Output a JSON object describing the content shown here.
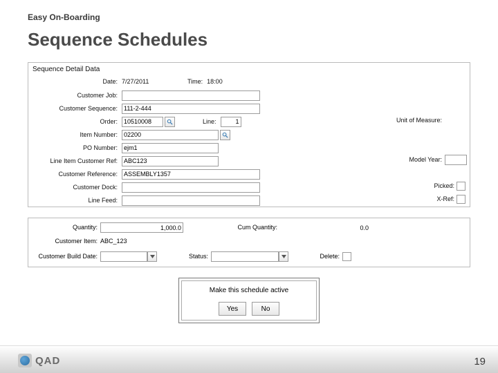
{
  "header": {
    "kicker": "Easy On-Boarding",
    "title": "Sequence Schedules"
  },
  "panel1": {
    "section_title": "Sequence Detail Data",
    "date_label": "Date:",
    "date_value": "7/27/2011",
    "time_label": "Time:",
    "time_value": "18:00",
    "customer_job_label": "Customer Job:",
    "customer_job_value": "",
    "customer_sequence_label": "Customer Sequence:",
    "customer_sequence_value": "111-2-444",
    "order_label": "Order:",
    "order_value": "10510008",
    "line_label": "Line:",
    "line_value": "1",
    "item_number_label": "Item Number:",
    "item_number_value": "02200",
    "po_number_label": "PO Number:",
    "po_number_value": "ejm1",
    "line_item_cust_ref_label": "Line Item Customer Ref:",
    "line_item_cust_ref_value": "ABC123",
    "customer_reference_label": "Customer Reference:",
    "customer_reference_value": "ASSEMBLY1357",
    "customer_dock_label": "Customer Dock:",
    "customer_dock_value": "",
    "line_feed_label": "Line Feed:",
    "line_feed_value": "",
    "uom_label": "Unit of Measure:",
    "model_year_label": "Model Year:",
    "model_year_value": "",
    "picked_label": "Picked:",
    "xref_label": "X-Ref:"
  },
  "panel2": {
    "quantity_label": "Quantity:",
    "quantity_value": "1,000.0",
    "cum_quantity_label": "Cum Quantity:",
    "cum_quantity_value": "0.0",
    "customer_item_label": "Customer Item:",
    "customer_item_value": "ABC_123",
    "build_date_label": "Customer Build Date:",
    "build_date_value": "",
    "status_label": "Status:",
    "status_value": "",
    "delete_label": "Delete:"
  },
  "dialog": {
    "message": "Make this schedule active",
    "yes": "Yes",
    "no": "No"
  },
  "footer": {
    "brand": "QAD",
    "page": "19"
  }
}
